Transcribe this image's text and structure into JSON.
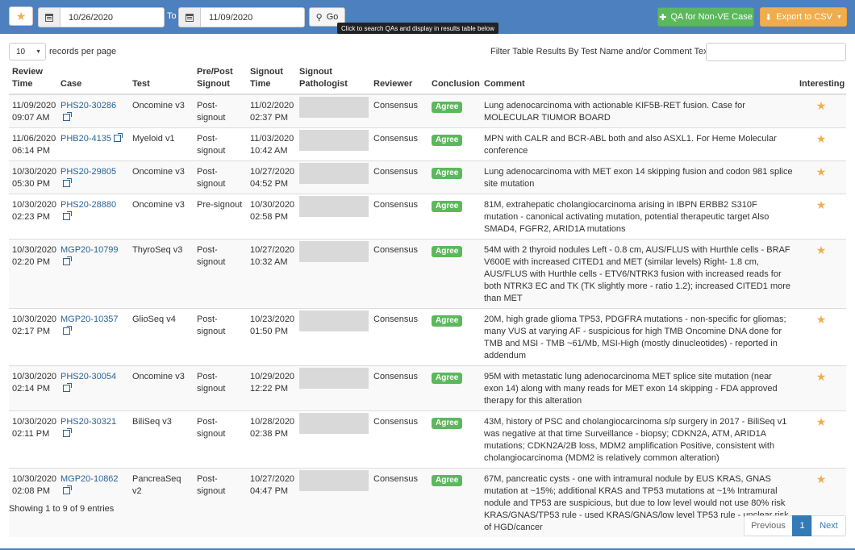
{
  "toolbar": {
    "from_date": "10/26/2020",
    "to_label": "To",
    "to_date": "11/09/2020",
    "go_label": "Go",
    "go_tooltip": "Click to search QAs and display in results table below",
    "qa_button_label": "QA for Non-VE Case",
    "export_button_label": "Export to CSV",
    "icons": {
      "favorites": "star-icon",
      "calendar": "calendar-icon",
      "search": "search-icon",
      "add": "plus-icon",
      "download": "download-icon",
      "caret": "caret-down-icon"
    }
  },
  "controls": {
    "page_length": "10",
    "records_label": "records per page",
    "filter_label": "Filter Table Results By Test Name and/or Comment Text:",
    "filter_value": ""
  },
  "table": {
    "headers": {
      "review_time": "Review Time",
      "case": "Case",
      "test": "Test",
      "pre_post": "Pre/Post Signout",
      "signout_time": "Signout Time",
      "signout_pathologist": "Signout Pathologist",
      "reviewer": "Reviewer",
      "conclusion": "Conclusion",
      "comment": "Comment",
      "interesting": "Interesting"
    },
    "rows": [
      {
        "review_date": "11/09/2020",
        "review_time": "09:07 AM",
        "case": "PHS20-30286",
        "test": "Oncomine v3",
        "signout": "Post-signout",
        "signout_date": "11/02/2020",
        "signout_time": "02:37 PM",
        "reviewer": "Consensus",
        "conclusion": "Agree",
        "comment": "Lung adenocarcinoma with actionable KIF5B-RET fusion. Case for MOLECULAR TIUMOR BOARD"
      },
      {
        "review_date": "11/06/2020",
        "review_time": "06:14 PM",
        "case": "PHB20-4135",
        "test": "Myeloid v1",
        "signout": "Post-signout",
        "signout_date": "11/03/2020",
        "signout_time": "10:42 AM",
        "reviewer": "Consensus",
        "conclusion": "Agree",
        "comment": "MPN with CALR and BCR-ABL both and also ASXL1. For Heme Molecular conference"
      },
      {
        "review_date": "10/30/2020",
        "review_time": "05:30 PM",
        "case": "PHS20-29805",
        "test": "Oncomine v3",
        "signout": "Post-signout",
        "signout_date": "10/27/2020",
        "signout_time": "04:52 PM",
        "reviewer": "Consensus",
        "conclusion": "Agree",
        "comment": "Lung adenocarcinoma with MET exon 14 skipping fusion and codon 981 splice site mutation"
      },
      {
        "review_date": "10/30/2020",
        "review_time": "02:23 PM",
        "case": "PHS20-28880",
        "test": "Oncomine v3",
        "signout": "Pre-signout",
        "signout_date": "10/30/2020",
        "signout_time": "02:58 PM",
        "reviewer": "Consensus",
        "conclusion": "Agree",
        "comment": "81M, extrahepatic cholangiocarcinoma arising in IBPN ERBB2 S310F mutation - canonical activating mutation, potential therapeutic target Also SMAD4, FGFR2, ARID1A mutations"
      },
      {
        "review_date": "10/30/2020",
        "review_time": "02:20 PM",
        "case": "MGP20-10799",
        "test": "ThyroSeq v3",
        "signout": "Post-signout",
        "signout_date": "10/27/2020",
        "signout_time": "10:32 AM",
        "reviewer": "Consensus",
        "conclusion": "Agree",
        "comment": "54M with 2 thyroid nodules Left - 0.8 cm, AUS/FLUS with Hurthle cells - BRAF V600E with increased CITED1 and MET (similar levels) Right- 1.8 cm, AUS/FLUS with Hurthle cells - ETV6/NTRK3 fusion with increased reads for both NTRK3 EC and TK (TK slightly more - ratio 1.2); increased CITED1 more than MET"
      },
      {
        "review_date": "10/30/2020",
        "review_time": "02:17 PM",
        "case": "MGP20-10357",
        "test": "GlioSeq v4",
        "signout": "Post-signout",
        "signout_date": "10/23/2020",
        "signout_time": "01:50 PM",
        "reviewer": "Consensus",
        "conclusion": "Agree",
        "comment": "20M, high grade glioma TP53, PDGFRA mutations - non-specific for gliomas; many VUS at varying AF - suspicious for high TMB Oncomine DNA done for TMB and MSI - TMB ~61/Mb, MSI-High (mostly dinucleotides) - reported in addendum"
      },
      {
        "review_date": "10/30/2020",
        "review_time": "02:14 PM",
        "case": "PHS20-30054",
        "test": "Oncomine v3",
        "signout": "Post-signout",
        "signout_date": "10/29/2020",
        "signout_time": "12:22 PM",
        "reviewer": "Consensus",
        "conclusion": "Agree",
        "comment": "95M with metastatic lung adenocarcinoma MET splice site mutation (near exon 14) along with many reads for MET exon 14 skipping - FDA approved therapy for this alteration"
      },
      {
        "review_date": "10/30/2020",
        "review_time": "02:11 PM",
        "case": "PHS20-30321",
        "test": "BiliSeq v3",
        "signout": "Post-signout",
        "signout_date": "10/28/2020",
        "signout_time": "02:38 PM",
        "reviewer": "Consensus",
        "conclusion": "Agree",
        "comment": "43M, history of PSC and cholangiocarcinoma s/p surgery in 2017 - BiliSeq v1 was negative at that time Surveillance - biopsy; CDKN2A, ATM, ARID1A mutations; CDKN2A/2B loss, MDM2 amplification Positive, consistent with cholangiocarcinoma (MDM2 is relatively common alteration)"
      },
      {
        "review_date": "10/30/2020",
        "review_time": "02:08 PM",
        "case": "MGP20-10862",
        "test": "PancreaSeq v2",
        "signout": "Post-signout",
        "signout_date": "10/27/2020",
        "signout_time": "04:47 PM",
        "reviewer": "Consensus",
        "conclusion": "Agree",
        "comment": "67M, pancreatic cysts - one with intramural nodule by EUS KRAS, GNAS mutation at ~15%; additional KRAS and TP53 mutations at ~1% Intramural nodule and TP53 are suspicious, but due to low level would not use 80% risk KRAS/GNAS/TP53 rule - used KRAS/GNAS/low level TP53 rule - unclear risk of HGD/cancer"
      }
    ]
  },
  "footer": {
    "info": "Showing 1 to 9 of 9 entries",
    "previous": "Previous",
    "page": "1",
    "next": "Next"
  },
  "colors": {
    "topbar": "#4d80bf",
    "success": "#5cb85c",
    "warning": "#f0ad4e",
    "link": "#2a6496",
    "primary": "#337ab7"
  }
}
